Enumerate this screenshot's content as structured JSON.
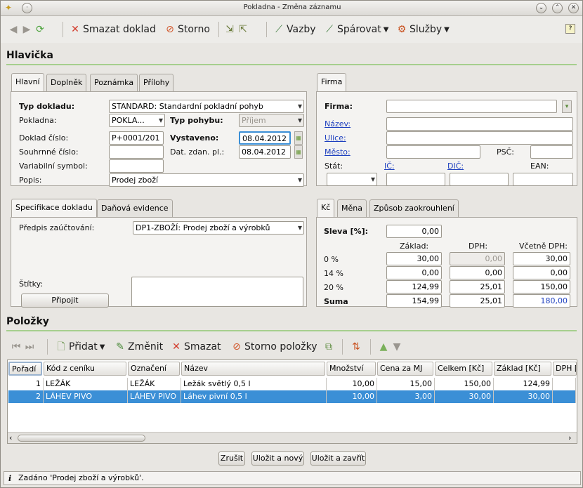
{
  "window": {
    "title": "Pokladna - Změna záznamu"
  },
  "toolbar": {
    "delete_label": "Smazat doklad",
    "storno_label": "Storno",
    "links_label": "Vazby",
    "pair_label": "Spárovat",
    "services_label": "Služby"
  },
  "header_section": {
    "title": "Hlavička"
  },
  "header_tabs": [
    "Hlavní",
    "Doplněk",
    "Poznámka",
    "Přílohy"
  ],
  "main_fields": {
    "type_label": "Typ dokladu:",
    "type_value": "STANDARD: Standardní pokladní pohyb",
    "cashbox_label": "Pokladna:",
    "cashbox_value": "POKLA...",
    "move_type_label": "Typ pohybu:",
    "move_type_value": "Příjem",
    "doc_no_label": "Doklad číslo:",
    "doc_no_value": "P+0001/201",
    "issued_label": "Vystaveno:",
    "issued_value": "08.04.2012",
    "summary_no_label": "Souhrnné číslo:",
    "tax_date_label": "Dat. zdan. pl.:",
    "tax_date_value": "08.04.2012",
    "var_symbol_label": "Variabilní symbol:",
    "desc_label": "Popis:",
    "desc_value": "Prodej zboží"
  },
  "firm_tabs": [
    "Firma"
  ],
  "firm_fields": {
    "firm_label": "Firma:",
    "name_label": "Název:",
    "street_label": "Ulice:",
    "city_label": "Město:",
    "zip_label": "PSČ:",
    "state_label": "Stát:",
    "ic_label": "IČ:",
    "dic_label": "DIČ:",
    "ean_label": "EAN:"
  },
  "spec_tabs": [
    "Specifikace dokladu",
    "Daňová evidence"
  ],
  "spec_fields": {
    "posting_label": "Předpis zaúčtování:",
    "posting_value": "DP1-ZBOŽÍ: Prodej zboží a výrobků",
    "tags_label": "Štítky:",
    "attach_button": "Připojit"
  },
  "currency_tabs": [
    "Kč",
    "Měna",
    "Způsob zaokrouhlení"
  ],
  "vat": {
    "discount_label": "Sleva [%]:",
    "discount_value": "0,00",
    "col_base": "Základ:",
    "col_vat": "DPH:",
    "col_total": "Včetně DPH:",
    "rows": [
      {
        "label": "0 %",
        "base": "30,00",
        "vat": "0,00",
        "total": "30,00"
      },
      {
        "label": "14 %",
        "base": "0,00",
        "vat": "0,00",
        "total": "0,00"
      },
      {
        "label": "20 %",
        "base": "124,99",
        "vat": "25,01",
        "total": "150,00"
      },
      {
        "label": "Suma",
        "base": "154,99",
        "vat": "25,01",
        "total": "180,00"
      }
    ]
  },
  "items_section": {
    "title": "Položky",
    "add_label": "Přidat",
    "edit_label": "Změnit",
    "delete_label": "Smazat",
    "storno_label": "Storno položky"
  },
  "items_table": {
    "columns": [
      "Pořadí",
      "Kód z ceníku",
      "Označení",
      "Název",
      "Množství",
      "Cena za MJ",
      "Celkem [Kč]",
      "Základ [Kč]",
      "DPH ["
    ],
    "rows": [
      [
        "1",
        "LEŽÁK",
        "LEŽÁK",
        "Ležák světlý 0,5 l",
        "10,00",
        "15,00",
        "150,00",
        "124,99",
        ""
      ],
      [
        "2",
        "LÁHEV PIVO",
        "LÁHEV PIVO",
        "Láhev pivní 0,5 l",
        "10,00",
        "3,00",
        "30,00",
        "30,00",
        ""
      ]
    ]
  },
  "buttons": {
    "cancel": "Zrušit",
    "save_new": "Uložit a nový",
    "save_close": "Uložit a zavřít"
  },
  "status": {
    "text": "Zadáno 'Prodej zboží a výrobků'."
  },
  "colors": {
    "accent_line": "#a6cf8e",
    "selection": "#3b8fd6",
    "link": "#1d3fbf"
  }
}
